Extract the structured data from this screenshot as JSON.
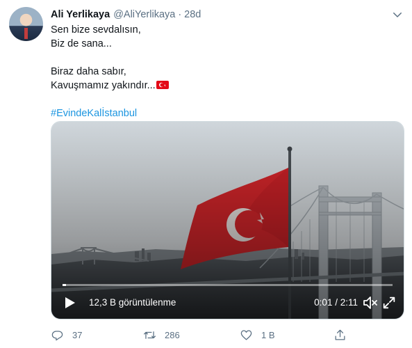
{
  "tweet": {
    "author_name": "Ali Yerlikaya",
    "handle": "@AliYerlikaya",
    "separator": "·",
    "time": "28d",
    "lines": [
      "Sen bize sevdalısın,",
      "Biz de sana...",
      "",
      "Biraz daha sabır,",
      "Kavuşmamız yakındır..."
    ],
    "flag_emoji": "turkey-flag",
    "hashtag": "#EvindeKalİstanbul"
  },
  "video": {
    "views": "12,3 B görüntülenme",
    "elapsed": "0:01",
    "time_separator": " / ",
    "duration": "2:11",
    "progress": 0.01
  },
  "actions": {
    "reply_count": "37",
    "retweet_count": "286",
    "like_count": "1 B"
  },
  "colors": {
    "link": "#1b95e0",
    "secondary": "#5b7083",
    "flag_red": "#e30a17"
  }
}
